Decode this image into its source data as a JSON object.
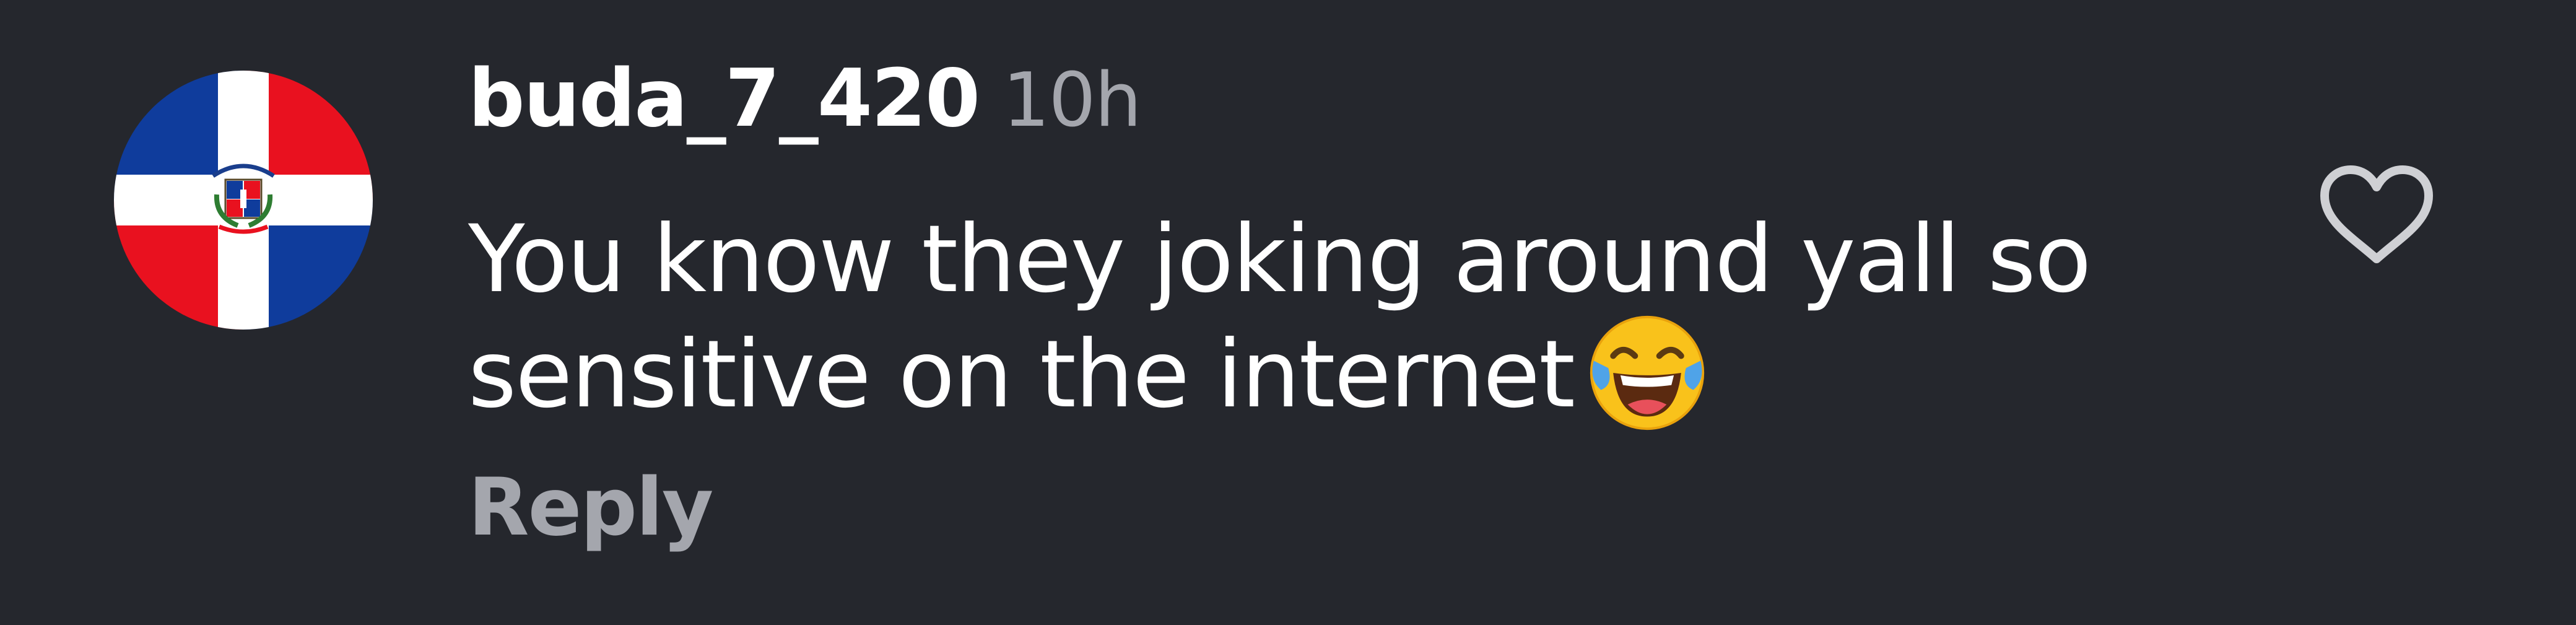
{
  "comment": {
    "username": "buda_7_420",
    "timestamp": "10h",
    "text_lines": [
      "You know they joking around yall so",
      "sensitive on the internet"
    ],
    "emoji": "face-with-tears-of-joy",
    "reply_label": "Reply",
    "avatar": {
      "icon": "dominican-republic-flag-icon",
      "colors": {
        "blue": "#0f3c9c",
        "red": "#e9111f",
        "white": "#ffffff"
      }
    },
    "like_icon": "heart-outline-icon"
  },
  "colors": {
    "background": "#25272d",
    "primary_text": "#ffffff",
    "secondary_text": "#a4a6ad",
    "icon": "#cfd0d4"
  }
}
